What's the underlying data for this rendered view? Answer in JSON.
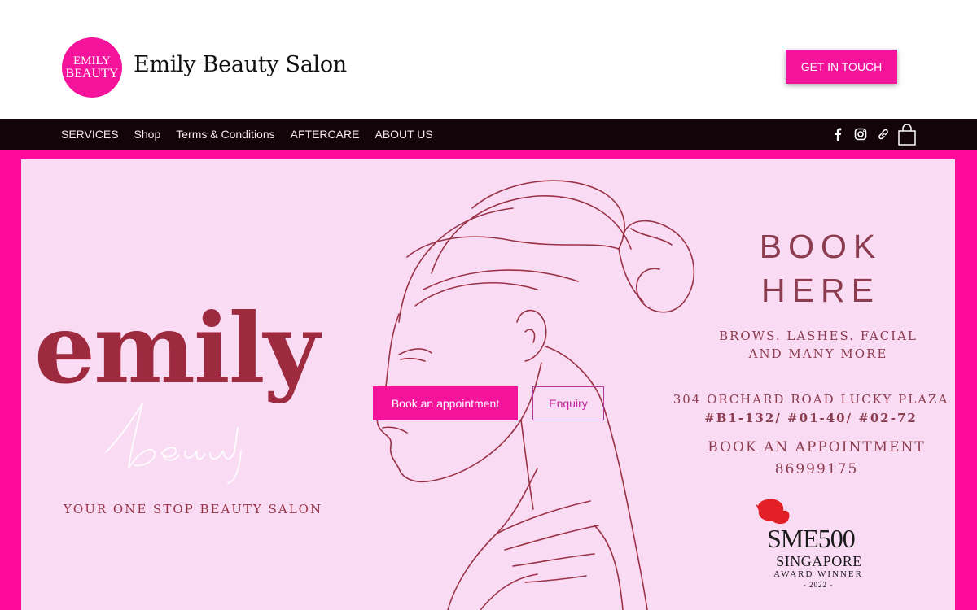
{
  "header": {
    "logo_line1": "EMILY",
    "logo_line2": "BEAUTY",
    "site_title": "Emily Beauty Salon",
    "cta_label": "GET IN TOUCH"
  },
  "nav": {
    "items": [
      "SERVICES",
      "Shop",
      "Terms & Conditions",
      "AFTERCARE",
      "ABOUT US"
    ],
    "social_icons": [
      "facebook-icon",
      "instagram-icon",
      "link-icon"
    ],
    "cart_icon": "shopping-bag-icon"
  },
  "hero": {
    "brand_word": "emily",
    "brand_script": "beauty",
    "tagline": "YOUR ONE STOP BEAUTY SALON",
    "book_button": "Book an appointment",
    "enquiry_button": "Enquiry",
    "book_here_line1": "BOOK",
    "book_here_line2": "HERE",
    "services_line1": "BROWS. LASHES. FACIAL",
    "services_line2": "AND MANY MORE",
    "address_line1": "304 ORCHARD ROAD LUCKY PLAZA",
    "address_line2": "#B1-132/ #01-40/ #02-72",
    "appointment_line1": "BOOK AN APPOINTMENT",
    "appointment_line2": "86999175",
    "award_title": "SME500",
    "award_country": "SINGAPORE",
    "award_label": "AWARD WINNER",
    "award_year": "- 2022 -"
  },
  "colors": {
    "accent": "#f5139b",
    "frame": "#ff0a9a",
    "hero_bg": "#fadbf4",
    "nav_bg": "#120409",
    "brand_text": "#9e2a3f",
    "info_text": "#8b3c4e"
  }
}
